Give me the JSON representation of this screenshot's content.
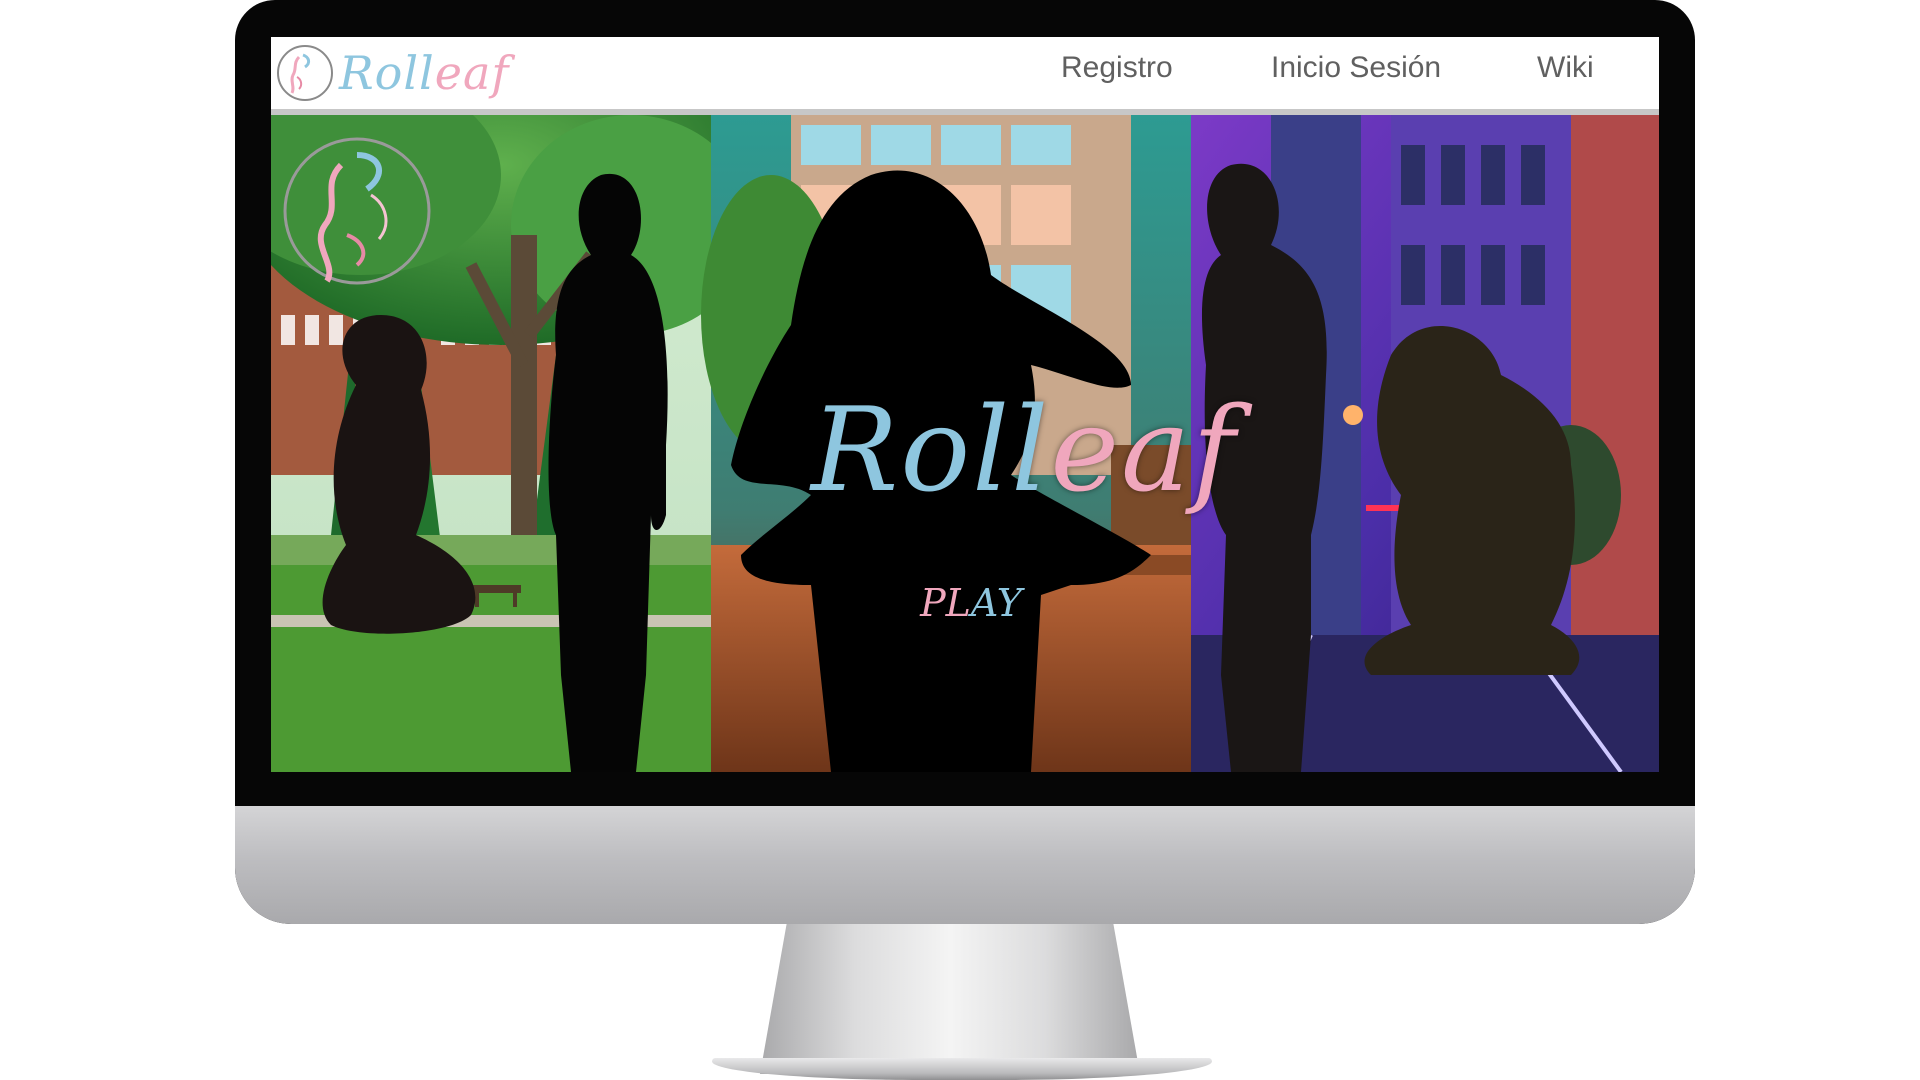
{
  "site": {
    "logo_text_part1": "Roll",
    "logo_text_part2": "eaf",
    "nav": {
      "registro": "Registro",
      "inicio_sesion": "Inicio Sesión",
      "wiki": "Wiki"
    }
  },
  "hero": {
    "title_part1": "Roll",
    "title_part2": "eaf",
    "play_p1": "PL",
    "play_p2": "AY"
  },
  "colors": {
    "brand_blue": "#8ec6df",
    "brand_pink": "#f0a7bd",
    "nav_text": "#606060"
  },
  "icons": {
    "logo": "rolleaf-circle-logo-icon"
  }
}
